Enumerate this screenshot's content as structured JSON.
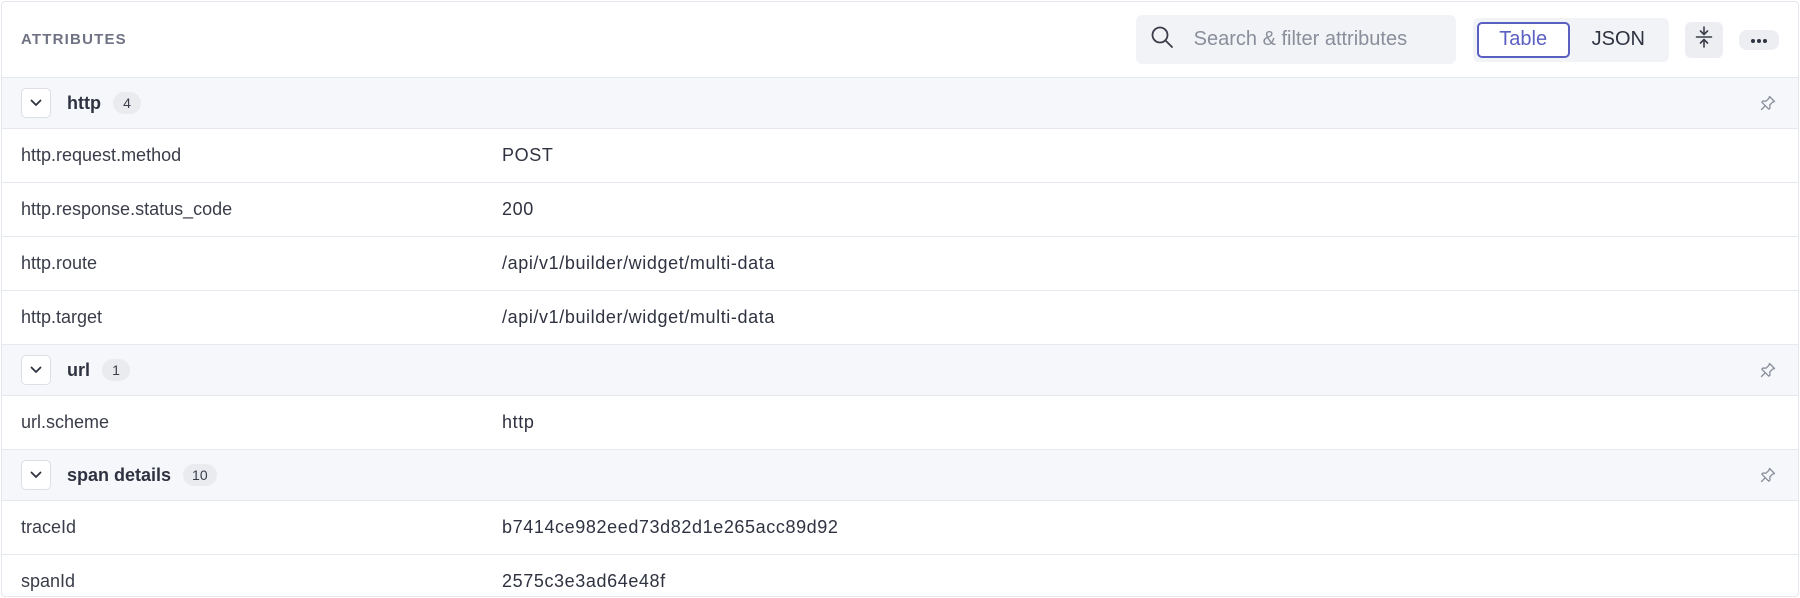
{
  "header": {
    "title": "ATTRIBUTES",
    "search_placeholder": "Search & filter attributes",
    "view_options": [
      "Table",
      "JSON"
    ],
    "active_view": "Table"
  },
  "groups": [
    {
      "name": "http",
      "count": "4",
      "rows": [
        {
          "key": "http.request.method",
          "value": "POST"
        },
        {
          "key": "http.response.status_code",
          "value": "200"
        },
        {
          "key": "http.route",
          "value": "/api/v1/builder/widget/multi-data"
        },
        {
          "key": "http.target",
          "value": "/api/v1/builder/widget/multi-data"
        }
      ]
    },
    {
      "name": "url",
      "count": "1",
      "rows": [
        {
          "key": "url.scheme",
          "value": "http"
        }
      ]
    },
    {
      "name": "span details",
      "count": "10",
      "rows": [
        {
          "key": "traceId",
          "value": "b7414ce982eed73d82d1e265acc89d92"
        },
        {
          "key": "spanId",
          "value": "2575c3e3ad64e48f"
        }
      ]
    }
  ],
  "colors": {
    "accent": "#5a5fc2",
    "group_bg": "#f6f7fa",
    "border": "#e6e8ef"
  },
  "icons": [
    "search-icon",
    "collapse-all-icon",
    "more-icon",
    "chevron-down-icon",
    "pin-icon"
  ]
}
